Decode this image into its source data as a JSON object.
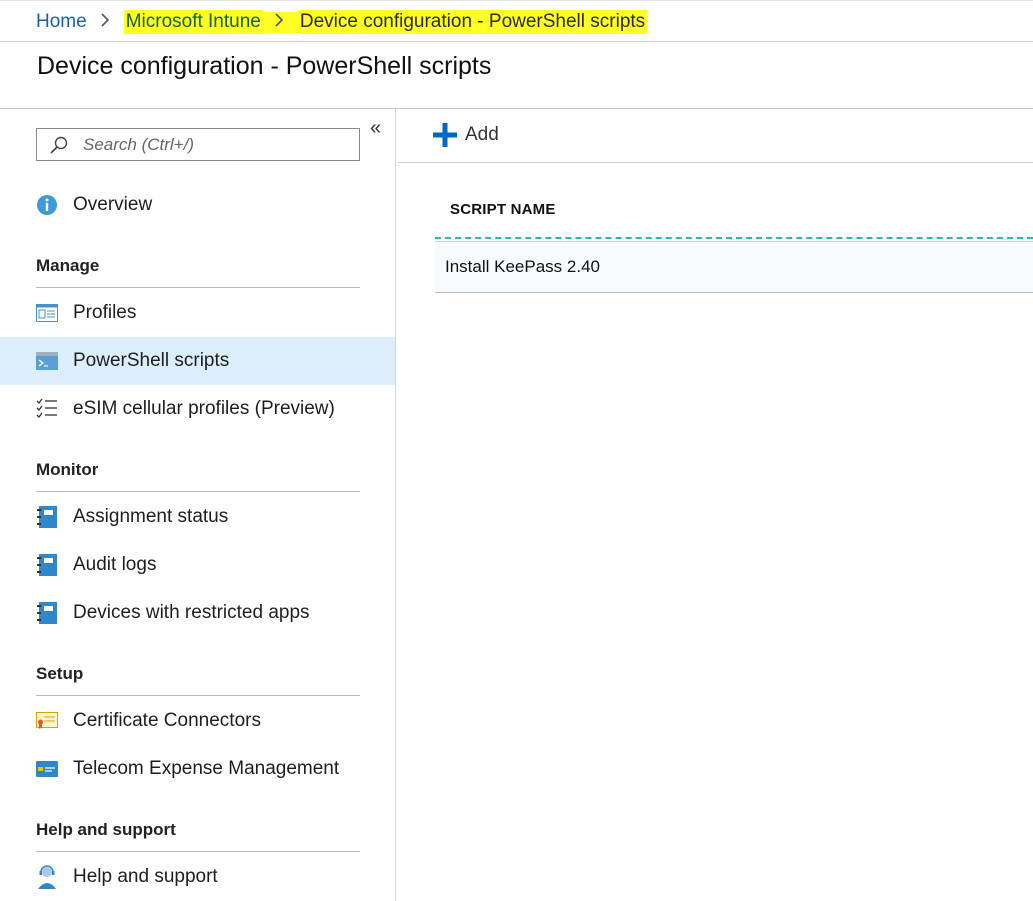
{
  "breadcrumb": {
    "home": "Home",
    "intune": "Microsoft Intune",
    "current": "Device configuration - PowerShell scripts",
    "separator": ">"
  },
  "page": {
    "title": "Device configuration - PowerShell scripts"
  },
  "sidebar": {
    "search_placeholder": "Search (Ctrl+/)",
    "collapse_glyph": "«",
    "overview": "Overview",
    "sections": {
      "manage": "Manage",
      "monitor": "Monitor",
      "setup": "Setup",
      "help": "Help and support"
    },
    "items": {
      "profiles": "Profiles",
      "powershell": "PowerShell scripts",
      "esim": "eSIM cellular profiles (Preview)",
      "assignment": "Assignment status",
      "audit": "Audit logs",
      "restricted": "Devices with restricted apps",
      "certificate": "Certificate Connectors",
      "telecom": "Telecom Expense Management",
      "helpsupport": "Help and support"
    },
    "selected": "powershell"
  },
  "toolbar": {
    "add_label": "Add"
  },
  "table": {
    "columns": [
      "SCRIPT NAME"
    ],
    "rows": [
      {
        "script_name": "Install KeePass 2.40"
      }
    ]
  },
  "colors": {
    "accent": "#0078d4",
    "highlight": "#ffff24",
    "selected_row": "#dceefb",
    "header_rule": "#2cb6ad"
  }
}
